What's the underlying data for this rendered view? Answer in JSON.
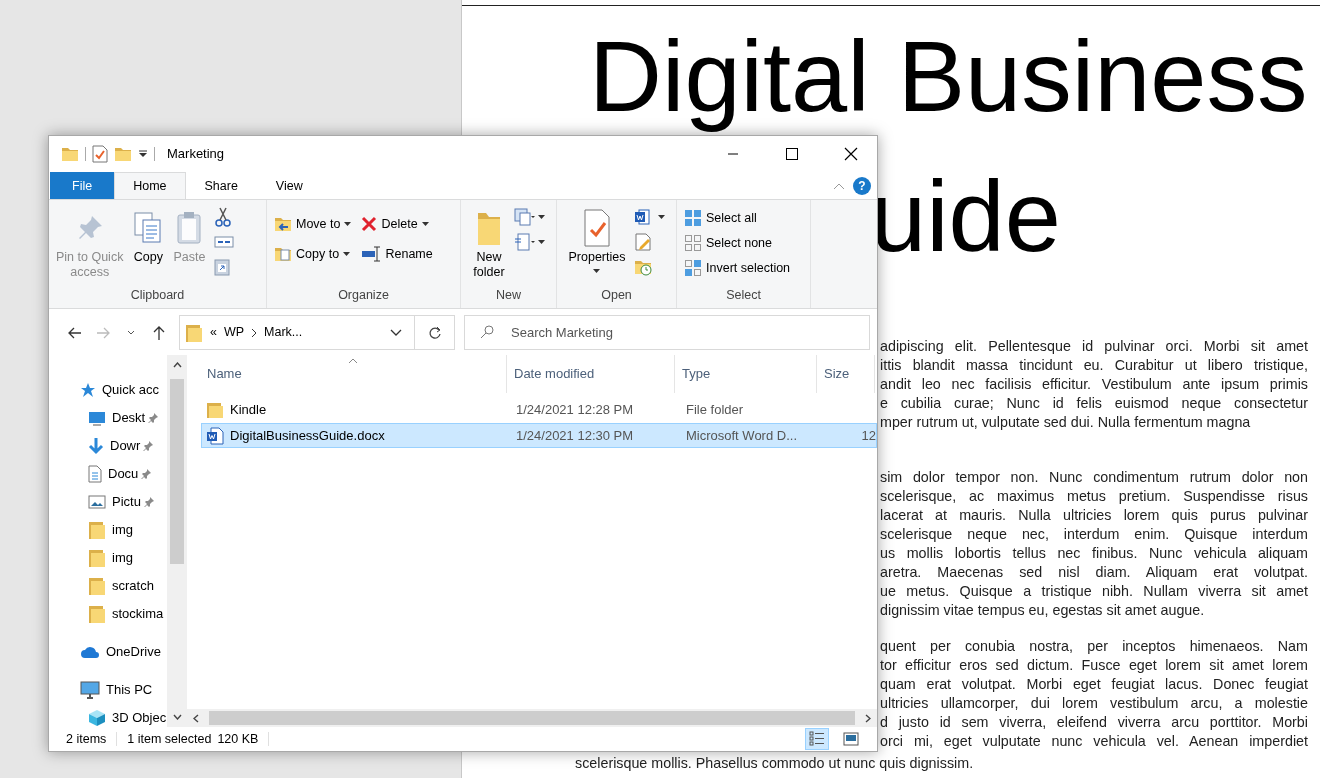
{
  "document": {
    "title_lines": [
      "Digital Business",
      "uide"
    ],
    "paragraphs": [
      {
        "lines": [
          "adipiscing elit. Pellentesque id pulvinar orci. Morbi sit amet",
          "ittis blandit massa tincidunt eu. Curabitur ut libero tristique,",
          "andit leo nec facilisis efficitur. Vestibulum ante ipsum primis",
          "e cubilia curae; Nunc id felis euismod neque consectetur",
          "mper rutrum ut, vulputate sed dui. Nulla fermentum magna"
        ]
      },
      {
        "lines": [
          "sim dolor tempor non. Nunc condimentum rutrum dolor non",
          "scelerisque, ac maximus metus pretium. Suspendisse risus",
          "lacerat at mauris. Nulla ultricies lorem quis purus pulvinar",
          "scelerisque neque nec, interdum enim. Quisque interdum",
          "us mollis lobortis tellus nec finibus. Nunc vehicula aliquam",
          "aretra. Maecenas sed nisl diam. Aliquam erat volutpat.",
          "ue metus. Quisque a tristique nibh. Nullam viverra sit amet",
          "dignissim vitae tempus eu, egestas sit amet augue."
        ]
      },
      {
        "lines": [
          "quent per conubia nostra, per inceptos himenaeos. Nam",
          "tor efficitur eros sed dictum. Fusce eget lorem sit amet lorem",
          "quam erat volutpat. Morbi eget feugiat lacus. Donec feugiat",
          "ultricies ullamcorper, dui lorem vestibulum arcu, a molestie",
          "d justo id sem viverra, eleifend viverra arcu porttitor. Morbi",
          "orci mi, eget vulputate nunc vehicula vel. Aenean imperdiet"
        ],
        "last_line": "scelerisque mollis. Phasellus commodo ut nunc quis dignissim."
      }
    ]
  },
  "explorer": {
    "title": "Marketing",
    "ribbon_tabs": [
      {
        "label": "File",
        "kind": "file",
        "selected": false
      },
      {
        "label": "Home",
        "kind": "tab",
        "selected": true
      },
      {
        "label": "Share",
        "kind": "tab",
        "selected": false
      },
      {
        "label": "View",
        "kind": "tab",
        "selected": false
      }
    ],
    "help": "?",
    "ribbon_groups": [
      {
        "label": "Clipboard",
        "items": [
          {
            "kind": "large",
            "label_lines": [
              "Pin to Quick",
              "access"
            ],
            "disabled": true,
            "dropdown": false
          },
          {
            "kind": "large",
            "label_lines": [
              "Copy"
            ],
            "disabled": false,
            "dropdown": false
          },
          {
            "kind": "large",
            "label_lines": [
              "Paste"
            ],
            "disabled": true,
            "dropdown": false
          },
          {
            "kind": "icons",
            "icons": [
              {
                "dropdown": false
              },
              {
                "dropdown": false
              },
              {
                "dropdown": false
              }
            ]
          }
        ]
      },
      {
        "label": "Organize",
        "items": [
          {
            "kind": "small",
            "commands": [
              {
                "label": "Move to",
                "dropdown": true
              },
              {
                "label": "Copy to",
                "dropdown": true
              }
            ]
          },
          {
            "kind": "small",
            "commands": [
              {
                "label": "Delete",
                "dropdown": true
              },
              {
                "label": "Rename",
                "dropdown": false
              }
            ]
          }
        ]
      },
      {
        "label": "New",
        "items": [
          {
            "kind": "large",
            "label_lines": [
              "New",
              "folder"
            ],
            "disabled": false,
            "dropdown": false
          },
          {
            "kind": "icons",
            "icons": [
              {
                "dropdown": true
              },
              {
                "dropdown": true
              }
            ]
          }
        ]
      },
      {
        "label": "Open",
        "items": [
          {
            "kind": "large",
            "label_lines": [
              "Properties"
            ],
            "disabled": false,
            "dropdown": true
          },
          {
            "kind": "icons",
            "icons": [
              {
                "dropdown": true
              },
              {
                "dropdown": false
              },
              {
                "dropdown": false
              }
            ]
          }
        ]
      },
      {
        "label": "Select",
        "items": [
          {
            "kind": "small",
            "commands": [
              {
                "label": "Select all",
                "dropdown": false
              },
              {
                "label": "Select none",
                "dropdown": false
              },
              {
                "label": "Invert selection",
                "dropdown": false
              }
            ]
          }
        ]
      }
    ],
    "address": {
      "overflow_marker": "«",
      "segments": [
        "WP",
        "Mark..."
      ]
    },
    "search": {
      "placeholder": "Search Marketing"
    },
    "nav": [
      {
        "label": "Quick acc",
        "kind": "quick_access",
        "pinned": false,
        "children": [
          {
            "label": "Deskt",
            "kind": "desktop",
            "pinned": true
          },
          {
            "label": "Dowr",
            "kind": "downloads",
            "pinned": true
          },
          {
            "label": "Docu",
            "kind": "documents",
            "pinned": true
          },
          {
            "label": "Pictu",
            "kind": "pictures",
            "pinned": true
          },
          {
            "label": "img",
            "kind": "folder",
            "pinned": false
          },
          {
            "label": "img",
            "kind": "folder",
            "pinned": false
          },
          {
            "label": "scratch",
            "kind": "folder",
            "pinned": false
          },
          {
            "label": "stockima",
            "kind": "folder",
            "pinned": false
          }
        ]
      },
      {
        "label": "OneDrive",
        "kind": "onedrive",
        "pinned": false
      },
      {
        "label": "This PC",
        "kind": "this_pc",
        "pinned": false,
        "children": [
          {
            "label": "3D Objec",
            "kind": "objects",
            "pinned": false
          }
        ]
      }
    ],
    "columns": [
      {
        "label": "Name",
        "sorted": true
      },
      {
        "label": "Date modified",
        "sorted": false
      },
      {
        "label": "Type",
        "sorted": false
      },
      {
        "label": "Size",
        "sorted": false
      }
    ],
    "files": [
      {
        "name": "Kindle",
        "kind": "folder",
        "date": "1/24/2021 12:28 PM",
        "type": "File folder",
        "selected": false
      },
      {
        "name": "DigitalBusinessGuide.docx",
        "kind": "word",
        "date": "1/24/2021 12:30 PM",
        "type": "Microsoft Word D...",
        "size": "12",
        "selected": true
      }
    ],
    "status": {
      "count": "2 items",
      "selection": "1 item selected",
      "size": "120 KB"
    },
    "view_buttons": [
      {
        "kind": "details",
        "selected": true
      },
      {
        "kind": "large_icons",
        "selected": false
      }
    ]
  }
}
